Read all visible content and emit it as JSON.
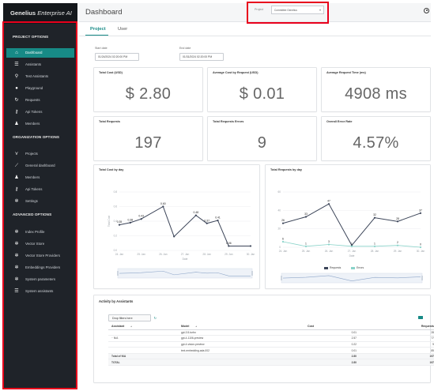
{
  "app": {
    "brand_bold": "Genelius",
    "brand_rest": " Enterprise AI"
  },
  "sidebar": {
    "project_section": "PROJECT OPTIONS",
    "organization_section": "ORGANIZATION OPTIONS",
    "advanced_section": "ADVANCED OPTIONS",
    "project_items": [
      {
        "label": "Dashboard",
        "icon": "home-icon",
        "active": true
      },
      {
        "label": "Assistants",
        "icon": "list-icon"
      },
      {
        "label": "Test Assistants",
        "icon": "search-icon"
      },
      {
        "label": "Playground",
        "icon": "chat-icon"
      },
      {
        "label": "Requests",
        "icon": "refresh-icon"
      },
      {
        "label": "Api Tokens",
        "icon": "key-icon"
      },
      {
        "label": "Members",
        "icon": "users-icon"
      }
    ],
    "organization_items": [
      {
        "label": "Projects",
        "icon": "projects-icon"
      },
      {
        "label": "General dashboard",
        "icon": "chart-icon"
      },
      {
        "label": "Members",
        "icon": "users-icon"
      },
      {
        "label": "Api Tokens",
        "icon": "key-icon"
      },
      {
        "label": "Settings",
        "icon": "gear-icon"
      }
    ],
    "advanced_items": [
      {
        "label": "Index Profile",
        "icon": "gear-icon"
      },
      {
        "label": "Vector Store",
        "icon": "gear-icon"
      },
      {
        "label": "Vector Store Providers",
        "icon": "gear-icon"
      },
      {
        "label": "Embeddings Providers",
        "icon": "gear-icon"
      },
      {
        "label": "System parameters",
        "icon": "gear-icon"
      },
      {
        "label": "System assistants",
        "icon": "list-icon"
      }
    ]
  },
  "header": {
    "title": "Dashboard",
    "project_label": "Project",
    "project_value": "Committee Genelius"
  },
  "tabs": [
    {
      "label": "Project",
      "active": true
    },
    {
      "label": "User"
    }
  ],
  "filters": {
    "start_label": "Start date",
    "start_value": "01/24/2024 02:20:00 PM",
    "end_label": "End date",
    "end_value": "01/31/2024 02:20:00 PM"
  },
  "metrics": [
    {
      "title": "Total Cost (USD)",
      "value": "$ 2.80"
    },
    {
      "title": "Average Cost by Request (USD)",
      "value": "$ 0.01"
    },
    {
      "title": "Average Request Time (ms)",
      "value": "4908 ms"
    },
    {
      "title": "Total Requests",
      "value": "197"
    },
    {
      "title": "Total Requests Errors",
      "value": "9"
    },
    {
      "title": "Overall Error Rate",
      "value": "4.57%"
    }
  ],
  "colors": {
    "accent": "#178a86",
    "highlight": "#e8001c",
    "sidebar_bg": "#1f2329",
    "line": "#3b4458",
    "errors": "#89d3c9"
  },
  "chart_data": [
    {
      "type": "line",
      "title": "Total Cost by day",
      "xlabel": "Date",
      "ylabel": "Total Cost",
      "categories": [
        "24. Jan",
        "25. Jan",
        "26. Jan",
        "27. Jan",
        "28. Jan",
        "29. Jan",
        "30. Jan"
      ],
      "x": [
        0,
        0.5,
        1,
        2,
        2.5,
        3.5,
        4,
        4.5,
        5,
        6
      ],
      "series": [
        {
          "values": [
            0.35,
            0.38,
            0.43,
            0.6,
            0.19,
            0.48,
            0.37,
            0.41,
            0.06,
            0.06
          ]
        }
      ],
      "data_labels": [
        "0.35",
        "0.38",
        "0.43",
        "0.60",
        "",
        "0.48",
        "0.37",
        "0.41",
        "0.06",
        ""
      ],
      "y_ticks": [
        "0.0",
        "0.2",
        "0.4",
        "0.6",
        "0.8"
      ],
      "ylim": [
        0,
        0.8
      ],
      "grid": true
    },
    {
      "type": "line",
      "title": "Total Requests by day",
      "xlabel": "Date",
      "categories": [
        "24. Jan",
        "25. Jan",
        "26. Jan",
        "27. Jan",
        "28. Jan",
        "29. Jan",
        "30. Jan"
      ],
      "x": [
        0,
        1,
        2,
        3,
        4,
        5,
        6
      ],
      "series": [
        {
          "name": "Requests",
          "values": [
            26,
            33,
            47,
            2,
            32,
            28,
            37
          ]
        },
        {
          "name": "Errors",
          "values": [
            6,
            1,
            3,
            1,
            1,
            2,
            0
          ]
        }
      ],
      "data_labels": [
        "26",
        "33",
        "47",
        "",
        "32",
        "28",
        "37"
      ],
      "error_labels": [
        "6",
        "1",
        "3",
        "1",
        "1",
        "2",
        "0"
      ],
      "y_ticks": [
        "0",
        "20",
        "40",
        "60"
      ],
      "ylim": [
        0,
        60
      ],
      "grid": true,
      "legend": "bottom-center"
    }
  ],
  "activity": {
    "title": "Activity by Assistants",
    "drop_filters_label": "Drop filters here",
    "columns": [
      "Assistant",
      "Model",
      "Cost",
      "Requests"
    ],
    "rows": [
      {
        "assistant": "",
        "model": "gpt-3.5-turbo",
        "cost": "0.01",
        "requests": "28"
      },
      {
        "assistant": "N/A",
        "model": "gpt-4-1106-preview",
        "cost": "2.57",
        "requests": "77"
      },
      {
        "assistant": "",
        "model": "gpt-4-vision-preview",
        "cost": "0.22",
        "requests": "9"
      },
      {
        "assistant": "",
        "model": "text-embedding-ada-002",
        "cost": "0.01",
        "requests": "85"
      }
    ],
    "total_group": {
      "label": "Total of N/A",
      "cost": "2.80",
      "requests": "197"
    },
    "total": {
      "label": "TOTAL",
      "cost": "2.80",
      "requests": "197"
    }
  }
}
